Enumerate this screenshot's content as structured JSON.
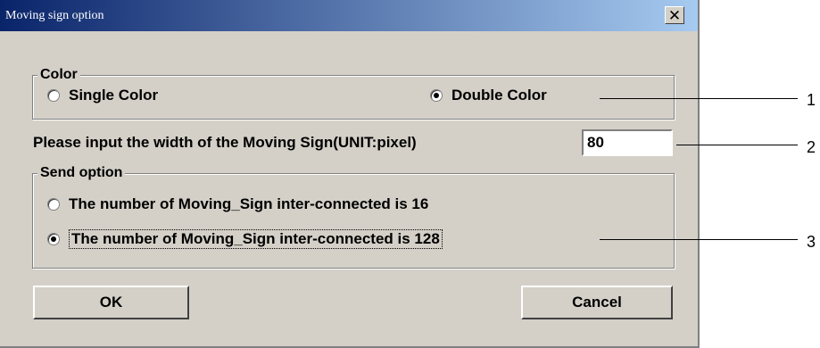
{
  "dialog": {
    "title": "Moving sign option",
    "close_glyph": "✕"
  },
  "color_group": {
    "legend": "Color",
    "options": [
      {
        "label": "Single Color",
        "selected": false
      },
      {
        "label": "Double Color",
        "selected": true
      }
    ]
  },
  "width_field": {
    "label": "Please input the width of the Moving Sign(UNIT:pixel)",
    "value": "80"
  },
  "send_group": {
    "legend": "Send option",
    "options": [
      {
        "label": "The number of Moving_Sign inter-connected is 16",
        "selected": false
      },
      {
        "label": "The number of Moving_Sign inter-connected is 128",
        "selected": true
      }
    ]
  },
  "buttons": {
    "ok": "OK",
    "cancel": "Cancel"
  },
  "callouts": [
    "1",
    "2",
    "3"
  ]
}
